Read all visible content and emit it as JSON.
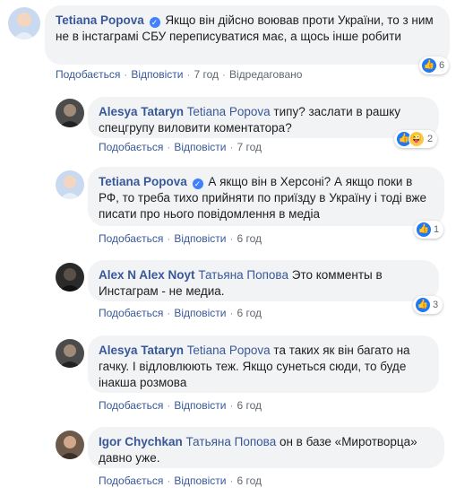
{
  "labels": {
    "like": "Подобається",
    "reply": "Відповісти",
    "edited": "Відредаговано",
    "sep": "·"
  },
  "comments": [
    {
      "author": "Tetiana Popova",
      "verified": true,
      "mention": "",
      "text": "Якщо він дійсно воював проти України, то з ним не в інстаграмі СБУ переписуватися має, а щось інше робити",
      "time": "7 год",
      "reactions": "6",
      "avatar_color": "#c9d9ef"
    },
    {
      "author": "Alesya Tataryn",
      "mention": "Tetiana Popova",
      "text": "типу? заслати в рашку спецгрупу виловити коментатора?",
      "time": "7 год",
      "reactions": "2",
      "avatar_color": "#4b4b4b"
    },
    {
      "author": "Tetiana Popova",
      "verified": true,
      "mention": "",
      "text": "А якщо він в Херсоні? А якщо поки в РФ, то треба тихо прийняти по приїзду в Україну і тоді вже писати про нього повідомлення в медіа",
      "time": "6 год",
      "reactions": "1",
      "avatar_color": "#c9d9ef"
    },
    {
      "author": "Alex N Alex Noyt",
      "mention": "Татьяна Попова",
      "text": "Это комменты в Инстаграм - не медиа.",
      "time": "6 год",
      "reactions": "3",
      "avatar_color": "#2a2a2a"
    },
    {
      "author": "Alesya Tataryn",
      "mention": "Tetiana Popova",
      "text": "та таких як він багато на гачку. І відловлюють теж. Якщо сунеться сюди, то буде інакша розмова",
      "time": "6 год",
      "reactions": "",
      "avatar_color": "#4b4b4b"
    },
    {
      "author": "Igor Chychkan",
      "mention": "Татьяна Попова",
      "text": "он в базе «Миротворца» давно уже.",
      "time": "6 год",
      "reactions": "",
      "avatar_color": "#6b5a4a"
    }
  ]
}
